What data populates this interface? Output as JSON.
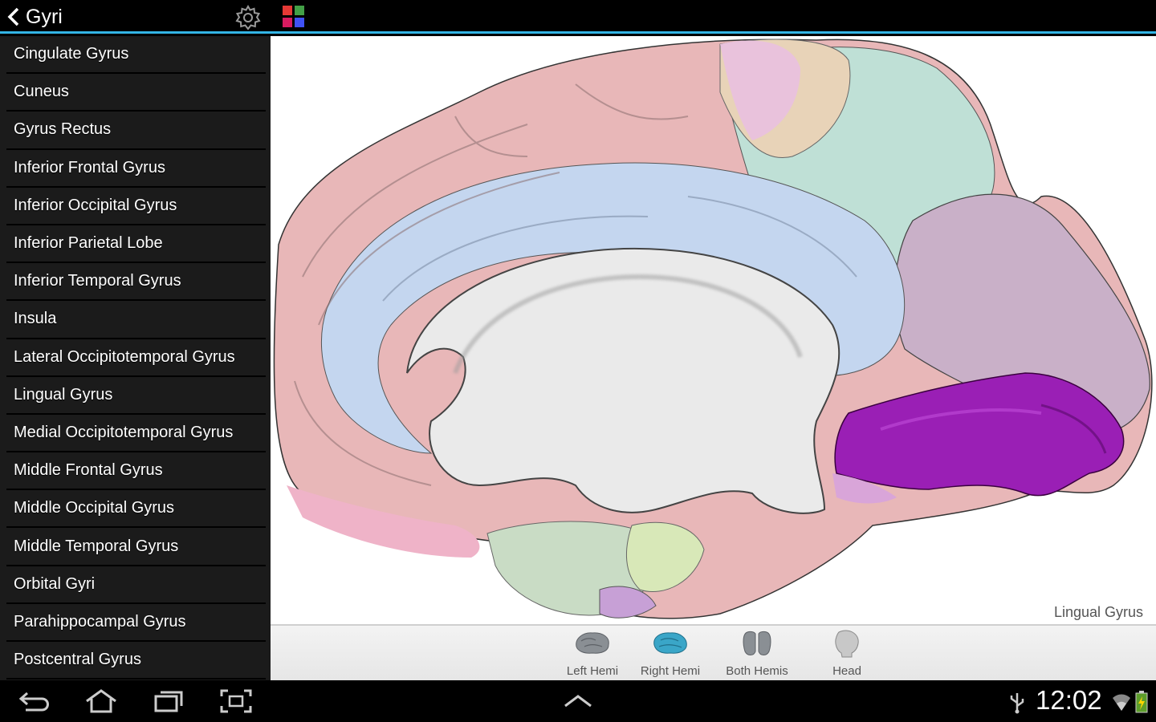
{
  "header": {
    "title": "Gyri"
  },
  "sidebar": {
    "items": [
      {
        "label": "Cingulate Gyrus"
      },
      {
        "label": "Cuneus"
      },
      {
        "label": "Gyrus Rectus"
      },
      {
        "label": "Inferior Frontal Gyrus"
      },
      {
        "label": "Inferior Occipital Gyrus"
      },
      {
        "label": "Inferior Parietal Lobe"
      },
      {
        "label": "Inferior Temporal Gyrus"
      },
      {
        "label": "Insula"
      },
      {
        "label": "Lateral Occipitotemporal Gyrus"
      },
      {
        "label": "Lingual Gyrus"
      },
      {
        "label": "Medial Occipitotemporal Gyrus"
      },
      {
        "label": "Middle Frontal Gyrus"
      },
      {
        "label": "Middle Occipital Gyrus"
      },
      {
        "label": "Middle Temporal Gyrus"
      },
      {
        "label": "Orbital Gyri"
      },
      {
        "label": "Parahippocampal Gyrus"
      },
      {
        "label": "Postcentral Gyrus"
      }
    ]
  },
  "viewer": {
    "selected_region": "Lingual Gyrus"
  },
  "views": {
    "left_hemi": "Left Hemi",
    "right_hemi": "Right Hemi",
    "both_hemis": "Both Hemis",
    "head": "Head"
  },
  "status": {
    "time": "12:02"
  },
  "colors": {
    "accent": "#33b5e5",
    "selected_view": "#3aa6c8",
    "highlight_region": "#9a1fb5"
  }
}
